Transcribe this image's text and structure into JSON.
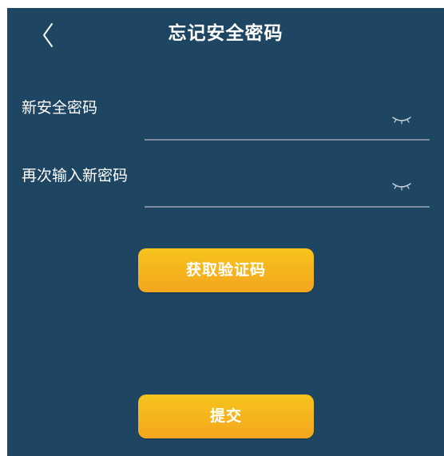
{
  "header": {
    "back_icon": "chevron-left-icon",
    "title": "忘记安全密码"
  },
  "form": {
    "new_password": {
      "label": "新安全密码",
      "value": "",
      "toggle_icon": "eye-closed-icon"
    },
    "confirm_password": {
      "label": "再次输入新密码",
      "value": "",
      "toggle_icon": "eye-closed-icon"
    }
  },
  "buttons": {
    "get_code_label": "获取验证码",
    "submit_label": "提交"
  },
  "colors": {
    "background": "#1e4562",
    "button_top": "#f6c41c",
    "button_bottom": "#f4a61e",
    "underline": "#7b8ea0",
    "text": "#ffffff"
  }
}
